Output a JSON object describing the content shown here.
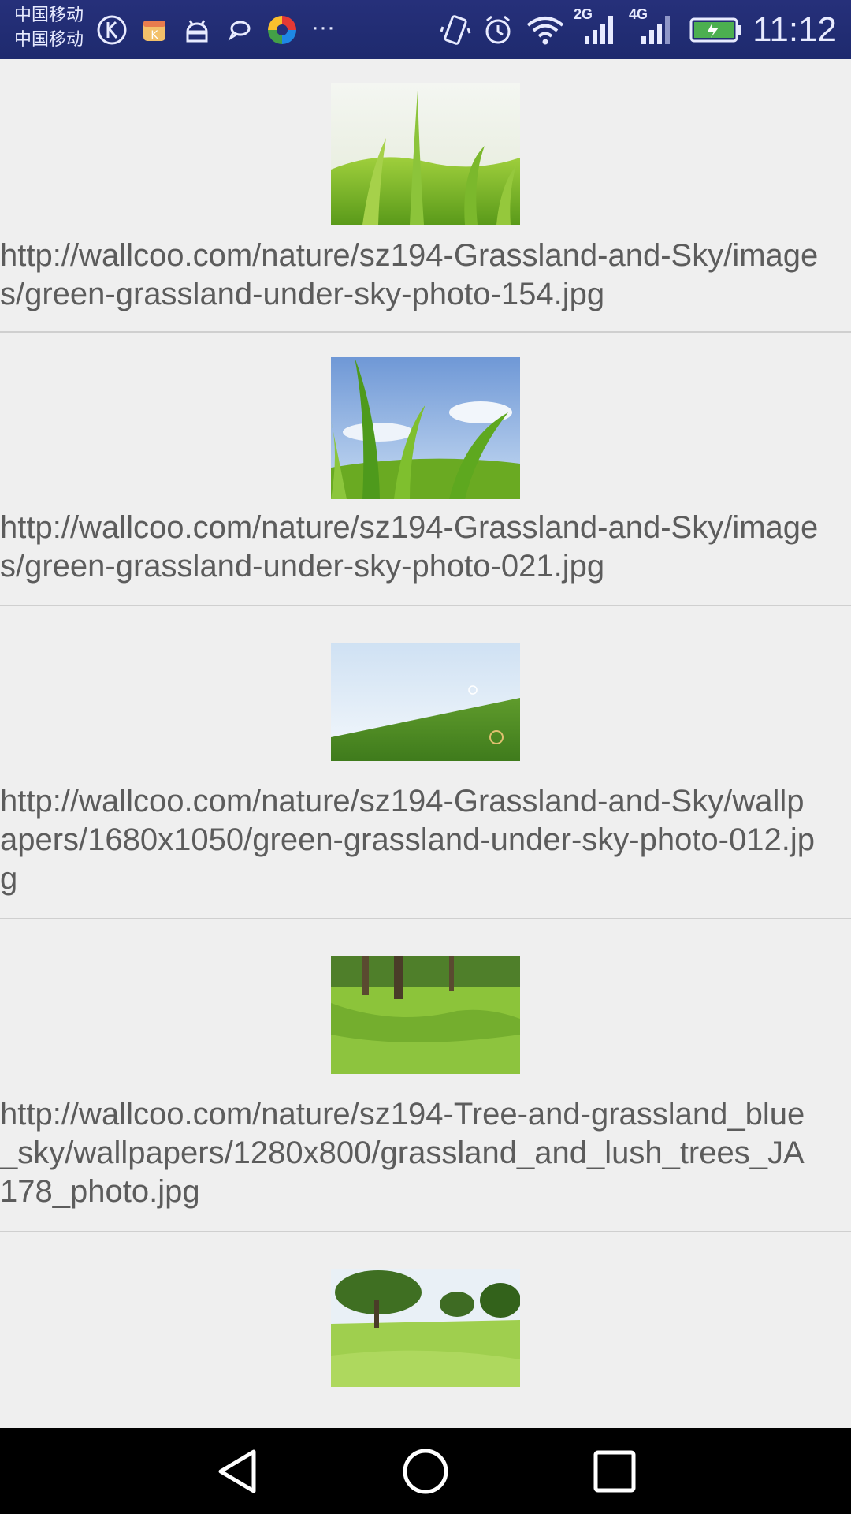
{
  "status_bar": {
    "carrier_1": "中国移动",
    "carrier_2": "中国移动",
    "more": "···",
    "net_2g": "2G",
    "net_4g": "4G",
    "time": "11:12",
    "icons": [
      "k-icon",
      "app-store-icon",
      "android-icon",
      "chat-bubble-icon",
      "colorful-browser-icon",
      "vibrate-icon",
      "alarm-icon",
      "wifi-icon",
      "signal-2g-icon",
      "signal-4g-icon",
      "battery-charging-icon"
    ]
  },
  "list": {
    "items": [
      {
        "image_icon": "grass-closeup-thumbnail",
        "url": "http://wallcoo.com/nature/sz194-Grassland-and-Sky/images/green-grassland-under-sky-photo-154.jpg"
      },
      {
        "image_icon": "grass-blades-sky-thumbnail",
        "url": "http://wallcoo.com/nature/sz194-Grassland-and-Sky/images/green-grassland-under-sky-photo-021.jpg"
      },
      {
        "image_icon": "grass-hill-sky-thumbnail",
        "url": "http://wallcoo.com/nature/sz194-Grassland-and-Sky/wallpapers/1680x1050/green-grassland-under-sky-photo-012.jpg"
      },
      {
        "image_icon": "grass-tree-shade-thumbnail",
        "url": "http://wallcoo.com/nature/sz194-Tree-and-grassland_blue_sky/wallpapers/1280x800/grassland_and_lush_trees_JA178_photo.jpg"
      },
      {
        "image_icon": "trees-meadow-thumbnail",
        "url": ""
      }
    ]
  },
  "nav_bar": {
    "icons": [
      "back-triangle-icon",
      "home-circle-icon",
      "recents-square-icon"
    ]
  },
  "colors": {
    "status_bar": "#26307a",
    "background": "#efefef",
    "text": "#5c5c5c",
    "divider": "#cfcfcf",
    "nav_bar": "#000000"
  }
}
